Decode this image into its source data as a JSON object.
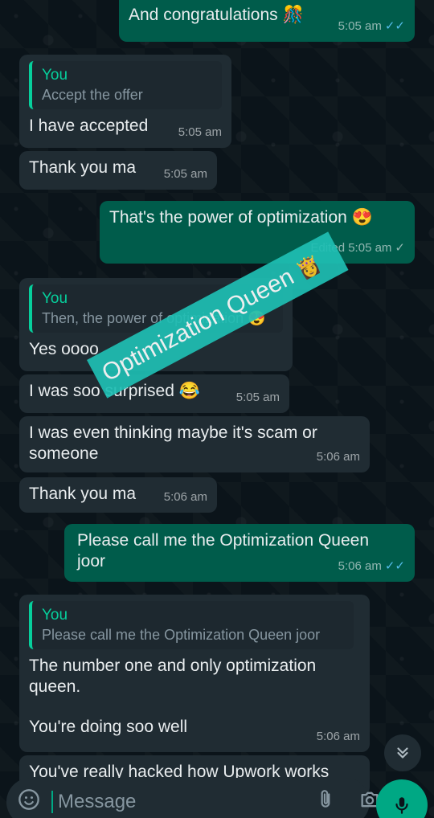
{
  "messages": [
    {
      "text": "And congratulations 🎊",
      "time": "5:05 am"
    },
    {
      "quote_author": "You",
      "quote_text": "Accept the offer",
      "text": "I have accepted",
      "time": "5:05 am"
    },
    {
      "text": "Thank you ma",
      "time": "5:05 am"
    },
    {
      "text": "That's the power of optimization 😍",
      "meta": "Edited",
      "time": "5:05 am"
    },
    {
      "quote_author": "You",
      "quote_text": "Then, the power of optimization 😍",
      "text": "Yes oooo"
    },
    {
      "text": "I was soo surprised 😂",
      "time": "5:05 am"
    },
    {
      "text": "I was even thinking maybe it's scam or someone",
      "time": "5:06 am"
    },
    {
      "text": "Thank you ma",
      "time": "5:06 am"
    },
    {
      "text": "Please call me the Optimization Queen joor",
      "time": "5:06 am"
    },
    {
      "quote_author": "You",
      "quote_text": "Please call me the Optimization Queen joor",
      "text": "The number one and only optimization queen.",
      "text2": "You're doing soo well",
      "time": "5:06 am"
    },
    {
      "text": "You've really hacked how Upwork works"
    }
  ],
  "watermark": {
    "text": "Optimization Queen",
    "emoji": "👸"
  },
  "composer": {
    "placeholder": "Message"
  },
  "icons": {
    "read": "✓✓",
    "sent": "✓",
    "scroll_down": "⌄",
    "emoji": "☺",
    "attach": "📎",
    "camera": "📷",
    "mic": "mic-icon"
  },
  "colors": {
    "incoming": "#202c33",
    "outgoing": "#005c4b",
    "accent": "#00a884",
    "read_ticks": "#53bdeb",
    "quote_author": "#06cf9c"
  }
}
